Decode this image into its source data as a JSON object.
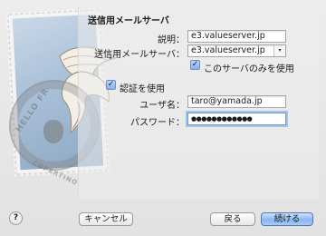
{
  "dialog": {
    "title": "送信用メールサーバ"
  },
  "form": {
    "description_label": "説明：",
    "description_value": "e3.valueserver.jp",
    "server_label": "送信用メールサーバ：",
    "server_value": "e3.valueserver.jp",
    "only_this_server_label": "このサーバのみを使用",
    "only_this_server_checked": true,
    "use_auth_label": "認証を使用",
    "use_auth_checked": true,
    "username_label": "ユーザ名：",
    "username_value": "taro@yamada.jp",
    "password_label": "パスワード：",
    "password_value": "●●●●●●●●●●●●"
  },
  "buttons": {
    "help": "?",
    "cancel": "キャンセル",
    "back": "戻る",
    "continue": "続ける"
  },
  "stamp": {
    "postmark_text": "HELLO FR",
    "postmark_text2": "CUPERTINO"
  },
  "icons": {
    "combo_arrow": "▾",
    "check": "✓"
  }
}
